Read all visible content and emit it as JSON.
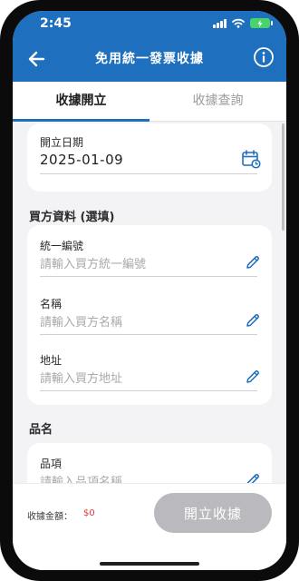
{
  "status_bar": {
    "time": "2:45"
  },
  "header": {
    "title": "免用統一發票收據"
  },
  "tabs": [
    {
      "label": "收據開立",
      "active": true
    },
    {
      "label": "收據查詢",
      "active": false
    }
  ],
  "date_card": {
    "label": "開立日期",
    "value": "2025-01-09"
  },
  "buyer_section": {
    "title": "買方資料 (選填)"
  },
  "buyer_fields": [
    {
      "label": "統一編號",
      "placeholder": "請輸入買方統一編號"
    },
    {
      "label": "名稱",
      "placeholder": "請輸入買方名稱"
    },
    {
      "label": "地址",
      "placeholder": "請輸入買方地址"
    }
  ],
  "items_section": {
    "title": "品名"
  },
  "item_field": {
    "label": "品項",
    "placeholder": "請輸入品項名稱"
  },
  "footer": {
    "total_label": "收據金額：",
    "total_value": "$0",
    "submit_label": "開立收據"
  },
  "colors": {
    "primary": "#1f6fbf",
    "danger": "#e53935",
    "disabled_button": "#b9b9be"
  }
}
